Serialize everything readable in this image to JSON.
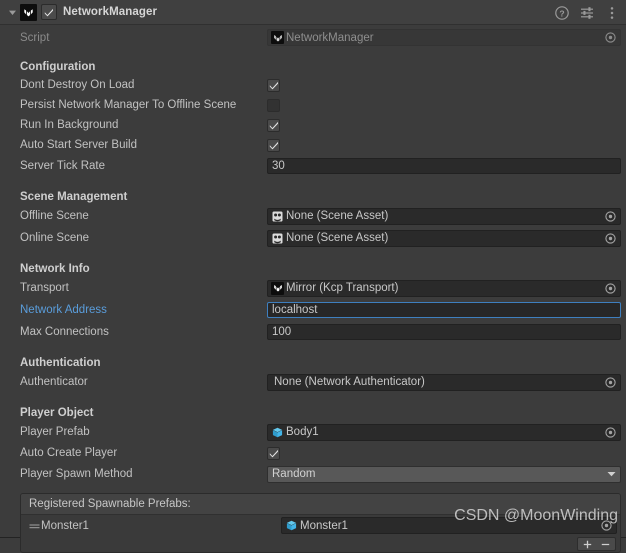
{
  "header": {
    "foldout_icon": "triangle-down-icon",
    "component_icon": "mirror-logo-icon",
    "enabled": true,
    "title": "NetworkManager",
    "help_icon": "help-icon",
    "preset_icon": "preset-settings-icon",
    "menu_icon": "kebab-menu-icon"
  },
  "script_row": {
    "label": "Script",
    "value": "NetworkManager",
    "icon": "mirror-script-icon",
    "picker_icon": "object-picker-icon"
  },
  "sections": {
    "configuration": {
      "title": "Configuration",
      "rows": [
        {
          "label": "Dont Destroy On Load",
          "value": true
        },
        {
          "label": "Persist Network Manager To Offline Scene",
          "value": false
        },
        {
          "label": "Run In Background",
          "value": true
        },
        {
          "label": "Auto Start Server Build",
          "value": true
        }
      ],
      "server_tick_rate": {
        "label": "Server Tick Rate",
        "value": "30"
      }
    },
    "scene_management": {
      "title": "Scene Management",
      "offline": {
        "label": "Offline Scene",
        "value": "None (Scene Asset)",
        "icon": "scene-asset-icon"
      },
      "online": {
        "label": "Online Scene",
        "value": "None (Scene Asset)",
        "icon": "scene-asset-icon"
      }
    },
    "network_info": {
      "title": "Network Info",
      "transport": {
        "label": "Transport",
        "value": "Mirror (Kcp Transport)",
        "icon": "mirror-script-icon"
      },
      "network_address": {
        "label": "Network Address",
        "value": "localhost",
        "placeholder": "localhost",
        "focused": true
      },
      "max_connections": {
        "label": "Max Connections",
        "value": "100"
      }
    },
    "authentication": {
      "title": "Authentication",
      "authenticator": {
        "label": "Authenticator",
        "value": "None (Network Authenticator)"
      }
    },
    "player_object": {
      "title": "Player Object",
      "player_prefab": {
        "label": "Player Prefab",
        "value": "Body1",
        "icon": "prefab-cube-icon"
      },
      "auto_create_player": {
        "label": "Auto Create Player",
        "value": true
      },
      "player_spawn_method": {
        "label": "Player Spawn Method",
        "value": "Random",
        "caret_icon": "chevron-down-icon"
      }
    }
  },
  "spawnable_prefabs": {
    "header": "Registered Spawnable Prefabs:",
    "items": [
      {
        "name": "Monster1",
        "value": "Monster1",
        "icon": "prefab-cube-icon",
        "handle_icon": "drag-handle-icon"
      }
    ],
    "add_icon": "plus-icon",
    "remove_icon": "minus-icon"
  },
  "watermark": {
    "text": "CSDN @MoonWinding"
  },
  "colors": {
    "background": "#3c3c3c",
    "header_bar": "#404040",
    "field_bg": "#2a2a2a",
    "dropdown_bg": "#585858",
    "accent_blue": "#5a9ddb",
    "focus_border": "#3e7fbf",
    "text": "#c2c2c2",
    "text_dim": "#8a8a8a",
    "prefab_blue": "#43b5e8"
  }
}
